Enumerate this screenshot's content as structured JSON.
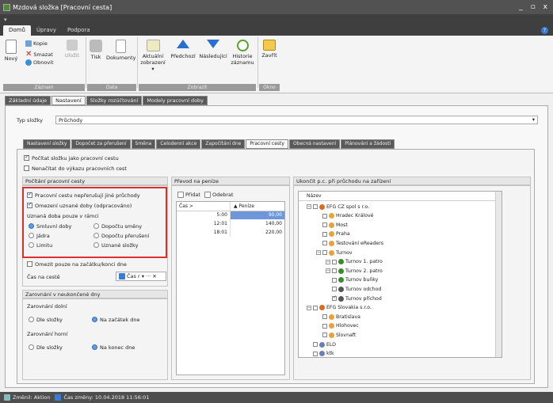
{
  "window": {
    "title": "Mzdová složka [Pracovní cesta]",
    "controls": [
      "_",
      "▫",
      "x"
    ]
  },
  "ribbon": {
    "tabs": [
      "Domů",
      "Úpravy",
      "Podpora"
    ],
    "help": "?",
    "groups": {
      "zaznam": {
        "label": "Záznam",
        "new": "Nový",
        "copy": "Kopie",
        "delete": "Smazat",
        "refresh": "Obnovit",
        "save": "Uložit"
      },
      "data": {
        "label": "Data",
        "print": "Tisk",
        "documents": "Dokumenty"
      },
      "zobrazit": {
        "label": "Zobrazit",
        "view_top": "Aktuální",
        "view_bottom": "zobrazení ▾",
        "prev": "Předchozí",
        "next": "Následující",
        "history_top": "Historie",
        "history_bottom": "záznamu"
      },
      "okno": {
        "label": "Okno",
        "close": "Zavřít"
      }
    }
  },
  "outer_tabs": [
    "Základní údaje",
    "Nastavení",
    "Složky rozúčtování",
    "Modely pracovní doby"
  ],
  "type_label": "Typ složky",
  "type_value": "Průchody",
  "inner_tabs": [
    "Nastavení složky",
    "Dopočet za přerušení",
    "Směna",
    "Celodenní akce",
    "Započítání dne",
    "Pracovní cesty",
    "Obecná nastavení",
    "Plánování a žádosti"
  ],
  "top_checks": {
    "count": "Počítat složku jako pracovní cestu",
    "noload": "Nenačítat do výkazu pracovních cest"
  },
  "calc": {
    "header": "Počítání pracovní cesty",
    "no_interrupt": "Pracovní cestu nepřerušují jiné průchody",
    "limit_time": "Omezení uznané doby (odpracováno)",
    "accepted_label": "Uznaná doba pouze v rámci",
    "opt_contract": "Smluvní doby",
    "opt_core": "Jádra",
    "opt_limit": "Limitu",
    "opt_shift": "Dopočtu směny",
    "opt_break": "Dopočtu přerušení",
    "opt_accepted": "Uznané složky",
    "only_begin": "Omezit pouze na začátku/konci dne",
    "time_label": "Čas na cestě",
    "time_combo": "Čas r ▾ ··· ✕"
  },
  "rounding": {
    "header": "Zarovnání v neukončené dny",
    "lower": "Zarovnání dolní",
    "upper": "Zarovnání horní",
    "by_item": "Dle složky",
    "to_start": "Na začátek dne",
    "to_end": "Na konec dne"
  },
  "money": {
    "header": "Převod na peníze",
    "add": "Přidat",
    "delete": "Odebrat",
    "columns": [
      "Čas >",
      "▲ Peníze"
    ],
    "rows": [
      [
        "5:00",
        "90,00"
      ],
      [
        "12:01",
        "140,00"
      ],
      [
        "18:01",
        "220,00"
      ]
    ]
  },
  "device": {
    "header": "Ukončit p.c. při průchodu na zařízení",
    "col": "Název",
    "nodes": [
      {
        "label": "EFG CZ spol s r.o.",
        "color": "#e06a1c",
        "checked": false
      },
      {
        "label": "Hradec Králové",
        "color": "#e8a23a",
        "checked": false
      },
      {
        "label": "Most",
        "color": "#e8a23a",
        "checked": false
      },
      {
        "label": "Praha",
        "color": "#e8a23a",
        "checked": false
      },
      {
        "label": "Testování eReaders",
        "color": "#e8a23a",
        "checked": false
      },
      {
        "label": "Turnov",
        "color": "#e8a23a",
        "checked": false
      },
      {
        "label": "Turnov 1. patro",
        "color": "#3b8b2e",
        "checked": false
      },
      {
        "label": "Turnov 2. patro",
        "color": "#3b8b2e",
        "checked": false
      },
      {
        "label": "Turnov buňky",
        "color": "#3b8b2e",
        "checked": false
      },
      {
        "label": "Turnov odchod",
        "color": "#555555",
        "checked": false
      },
      {
        "label": "Turnov příchod",
        "color": "#555555",
        "checked": true
      },
      {
        "label": "EFG Slovakia s.r.o.",
        "color": "#e06a1c",
        "checked": false
      },
      {
        "label": "Bratislava",
        "color": "#e8a23a",
        "checked": false
      },
      {
        "label": "Hlohovec",
        "color": "#e8a23a",
        "checked": false
      },
      {
        "label": "Slovnaft",
        "color": "#e8a23a",
        "checked": false
      },
      {
        "label": "ELO",
        "color": "#6a7fb5",
        "checked": false
      },
      {
        "label": "ktk",
        "color": "#6a7fb5",
        "checked": false
      }
    ]
  },
  "status": {
    "changed_label": "Změnil: Aktion",
    "time_label": "Čas změny: 10.04.2018 11:56:01"
  }
}
